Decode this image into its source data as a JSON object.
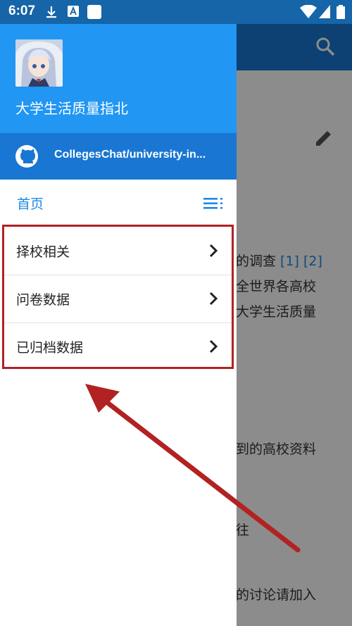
{
  "status_bar": {
    "time": "6:07"
  },
  "background_page": {
    "lines": [
      {
        "text": "的调查 ",
        "refs": "[1] [2]"
      },
      {
        "text": "全世界各高校",
        "refs": ""
      },
      {
        "text": "大学生活质量",
        "refs": ""
      },
      {
        "text": "到的高校资料",
        "refs": ""
      },
      {
        "text": "往",
        "refs": ""
      },
      {
        "text": "的讨论请加入",
        "refs": ""
      }
    ]
  },
  "drawer": {
    "title": "大学生活质量指北",
    "repo": "CollegesChat/university-in...",
    "home_label": "首页",
    "items": [
      {
        "label": "择校相关"
      },
      {
        "label": "问卷数据"
      },
      {
        "label": "已归档数据"
      }
    ]
  },
  "colors": {
    "header": "#2196f3",
    "repo_bar": "#1976d2",
    "annotation": "#b22222"
  }
}
